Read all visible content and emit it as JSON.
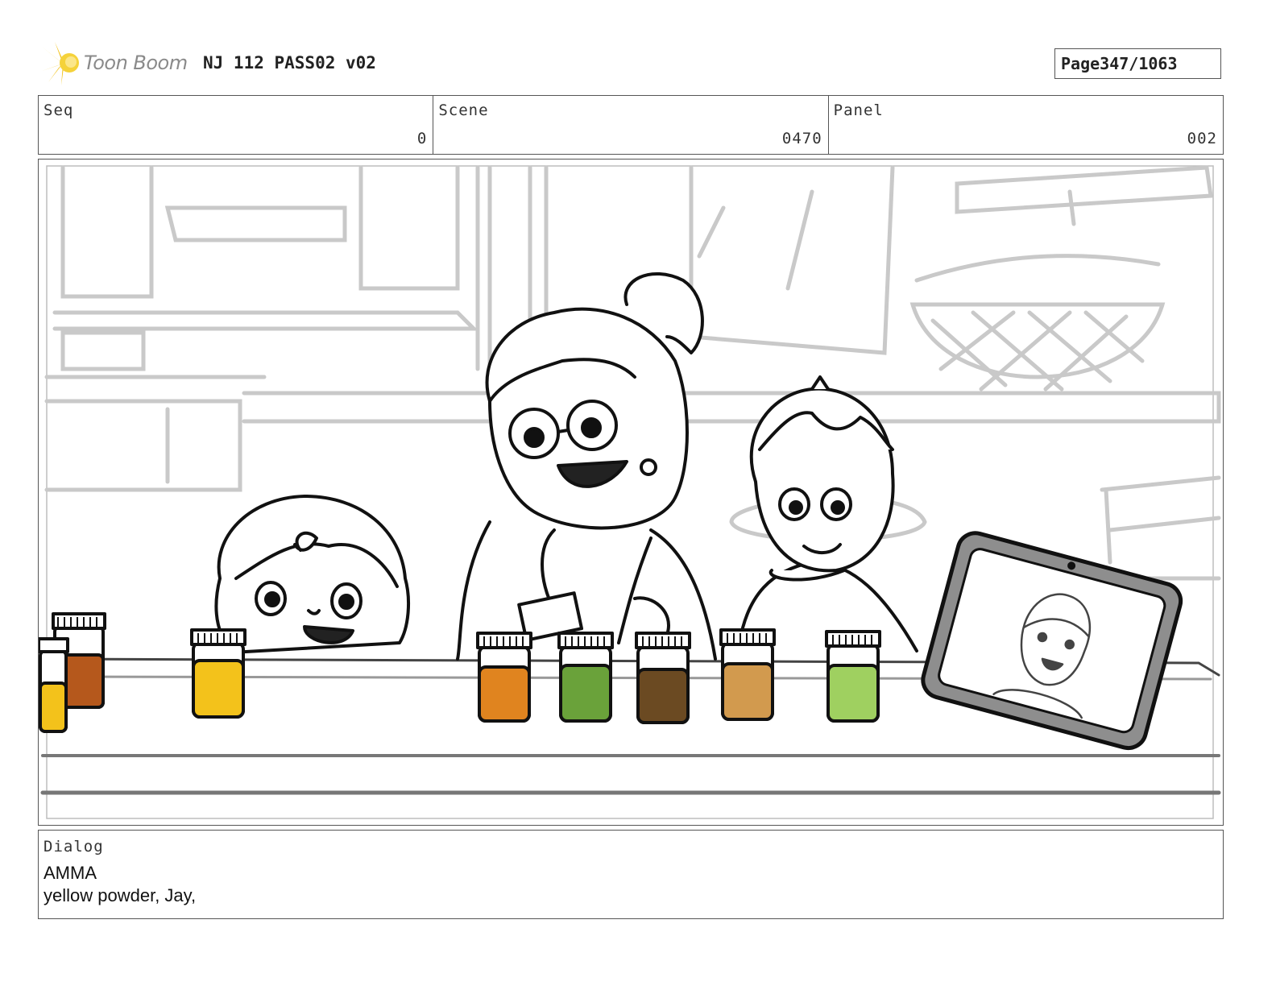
{
  "header": {
    "logo_text": "Toon Boom",
    "project_title": "NJ 112 PASS02 v02",
    "page_label": "Page",
    "page_number": "347/1063"
  },
  "info": {
    "seq_label": "Seq",
    "seq_value": "0",
    "scene_label": "Scene",
    "scene_value": "0470",
    "panel_label": "Panel",
    "panel_value": "002"
  },
  "dialog": {
    "label": "Dialog",
    "speaker": "AMMA",
    "line": "yellow powder, Jay,"
  },
  "colors": {
    "logo_yellow": "#f2c21a",
    "jar_yellow": "#f3c21b",
    "jar_orange": "#e0841f",
    "jar_green": "#6aa23a",
    "jar_brown": "#6b4a22",
    "jar_tan": "#d29a4e",
    "jar_lightgreen": "#9fd060",
    "jar_rust": "#b5581c",
    "tablet_frame": "#8e8e8e"
  }
}
